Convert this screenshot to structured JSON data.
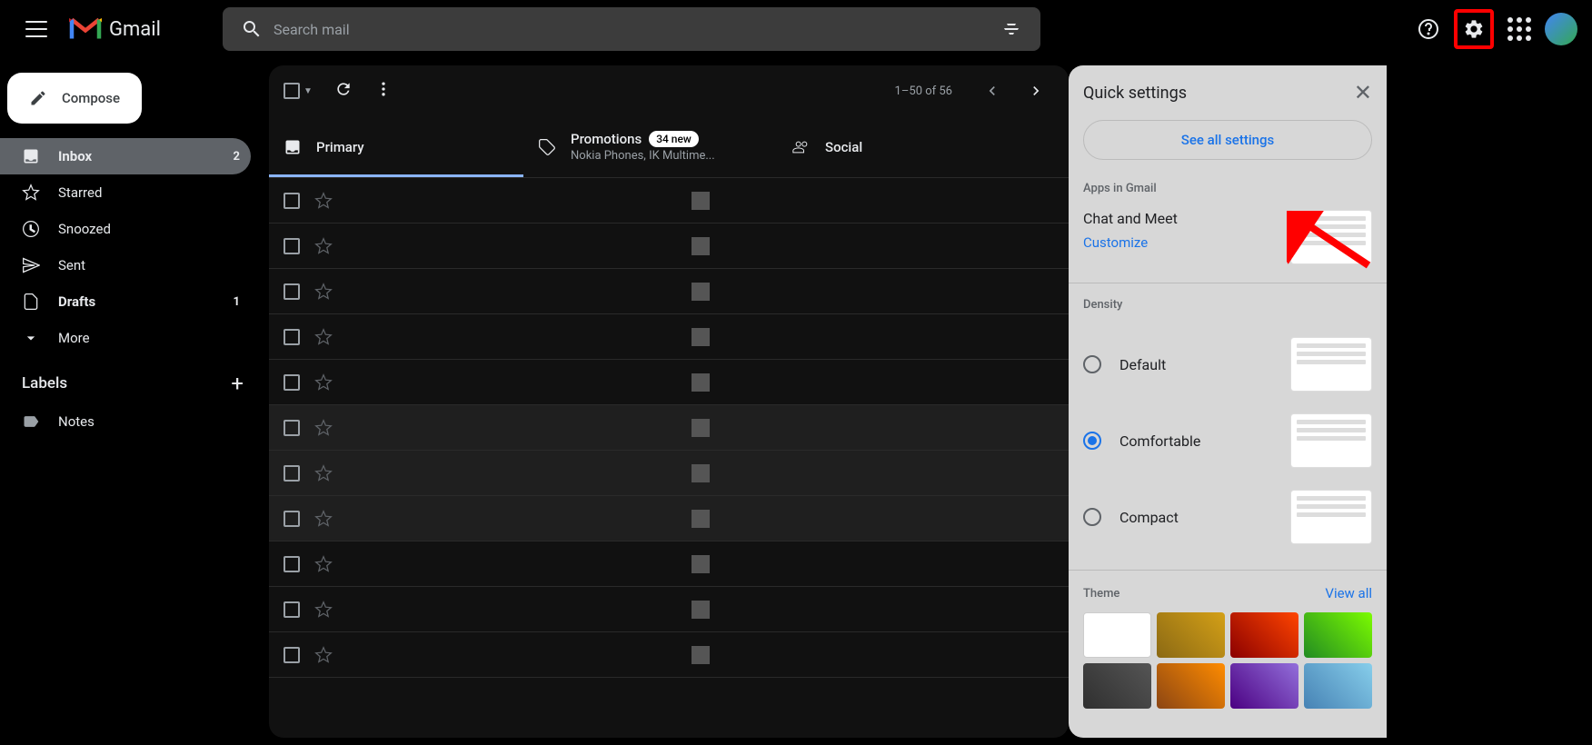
{
  "header": {
    "logo_text": "Gmail",
    "search_placeholder": "Search mail"
  },
  "compose_label": "Compose",
  "sidebar": {
    "items": [
      {
        "label": "Inbox",
        "count": "2",
        "active": true,
        "bold": true,
        "icon": "inbox"
      },
      {
        "label": "Starred",
        "icon": "star"
      },
      {
        "label": "Snoozed",
        "icon": "clock"
      },
      {
        "label": "Sent",
        "icon": "send"
      },
      {
        "label": "Drafts",
        "count": "1",
        "bold": true,
        "icon": "file"
      },
      {
        "label": "More",
        "icon": "chevron"
      }
    ],
    "labels_title": "Labels",
    "user_labels": [
      {
        "label": "Notes"
      }
    ]
  },
  "toolbar": {
    "page_info": "1–50 of 56"
  },
  "tabs": [
    {
      "label": "Primary",
      "active": true,
      "icon": "inbox"
    },
    {
      "label": "Promotions",
      "badge": "34 new",
      "sub": "Nokia Phones, IK Multime...",
      "icon": "tag"
    },
    {
      "label": "Social",
      "icon": "people"
    }
  ],
  "settings": {
    "title": "Quick settings",
    "see_all": "See all settings",
    "apps_section": "Apps in Gmail",
    "chat_meet": "Chat and Meet",
    "customize": "Customize",
    "density_section": "Density",
    "density_options": [
      {
        "label": "Default",
        "checked": false
      },
      {
        "label": "Comfortable",
        "checked": true
      },
      {
        "label": "Compact",
        "checked": false
      }
    ],
    "theme_section": "Theme",
    "view_all": "View all"
  }
}
